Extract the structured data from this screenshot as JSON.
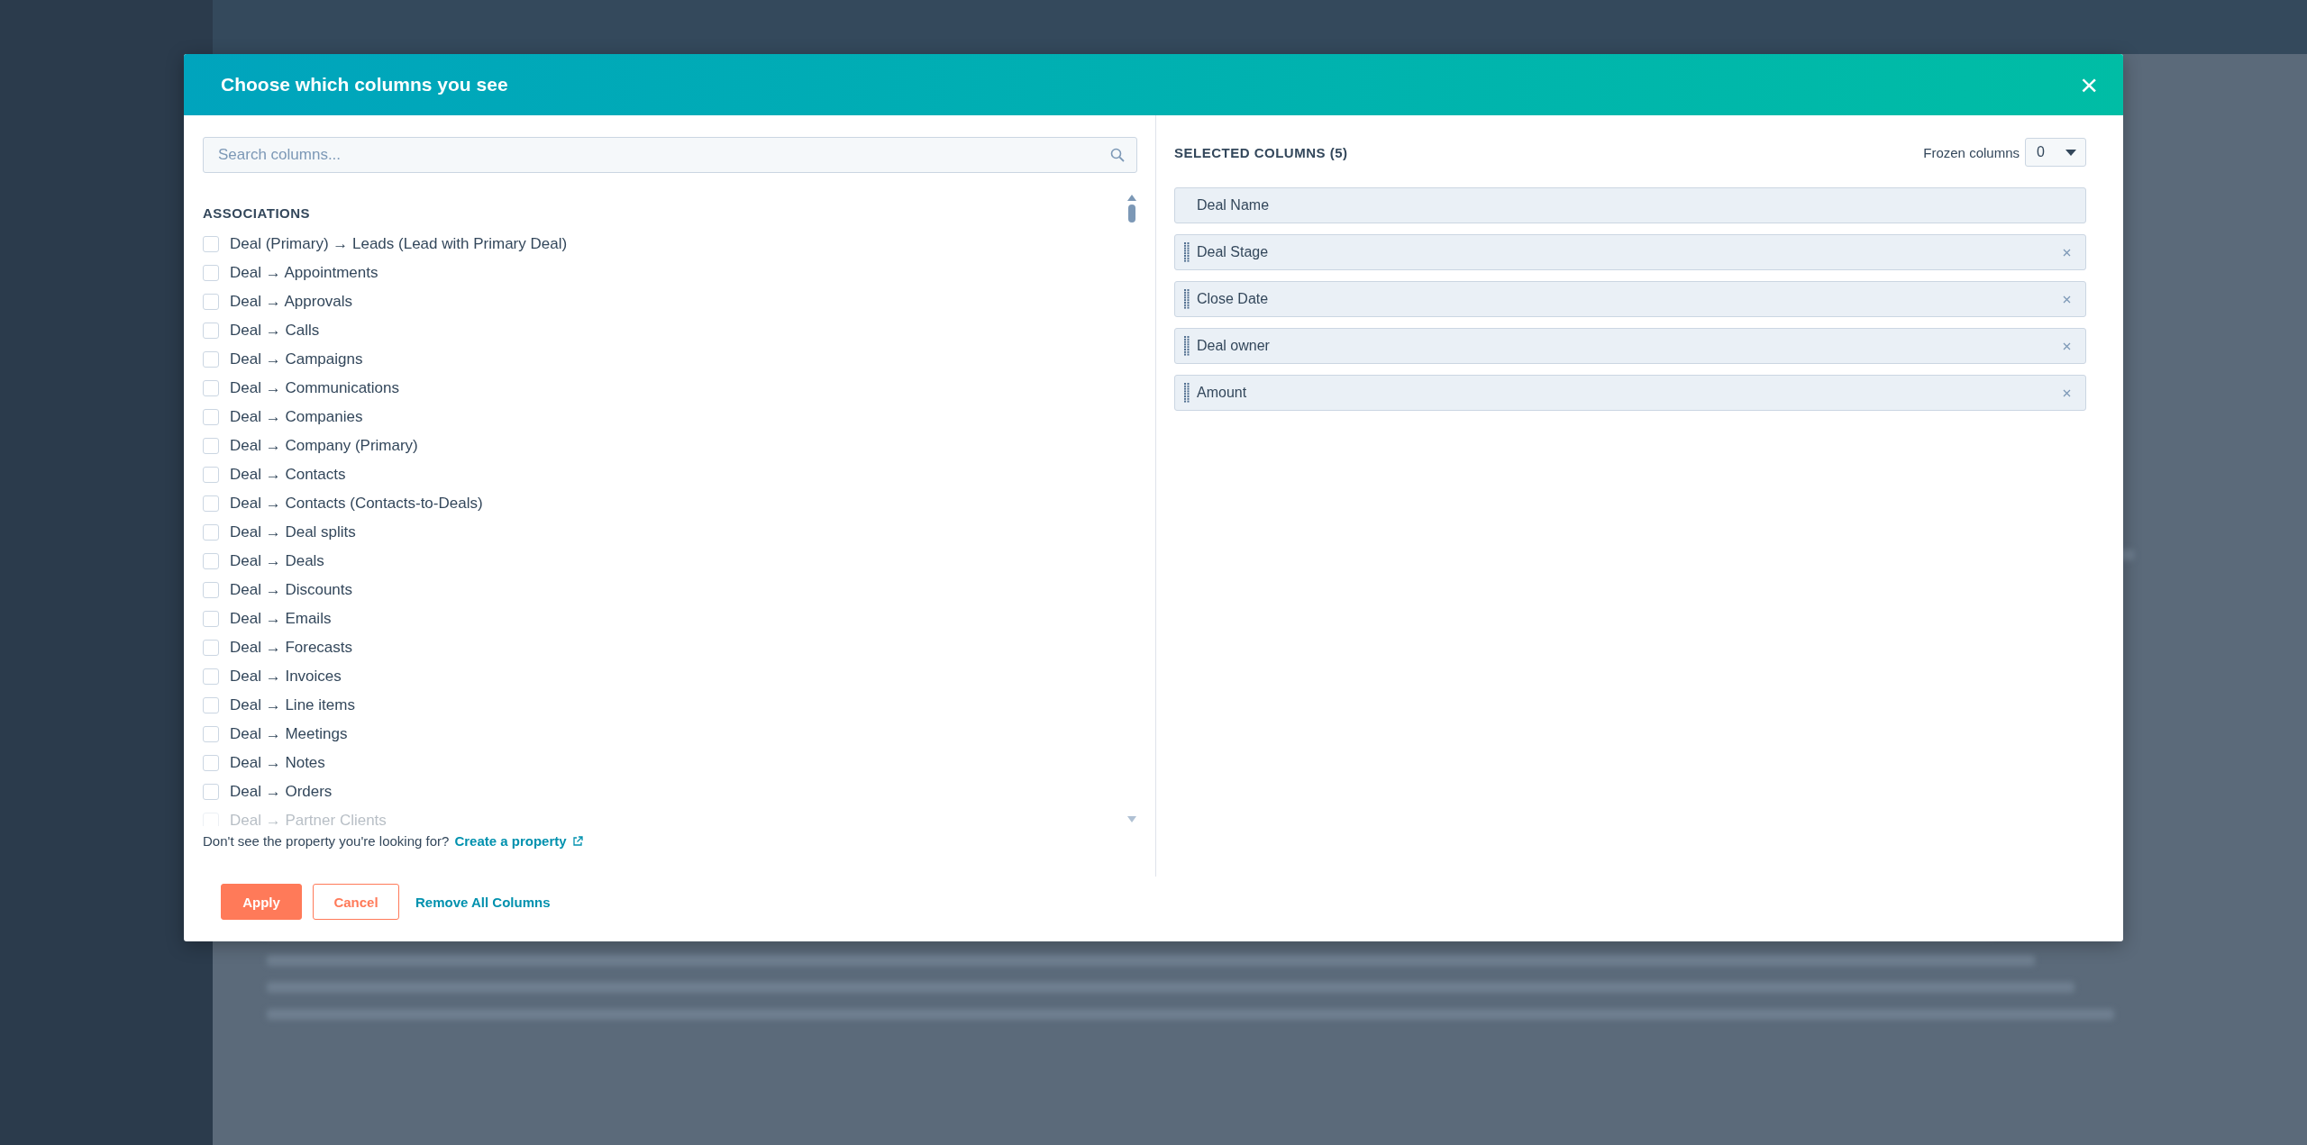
{
  "dialog": {
    "title": "Choose which columns you see",
    "close": "×"
  },
  "search": {
    "placeholder": "Search columns..."
  },
  "section": {
    "title": "ASSOCIATIONS",
    "items": [
      {
        "label": "Deal (Primary) → Leads (Lead with Primary Deal)",
        "checked": false
      },
      {
        "label": "Deal → Appointments",
        "checked": false
      },
      {
        "label": "Deal → Approvals",
        "checked": false
      },
      {
        "label": "Deal → Calls",
        "checked": false
      },
      {
        "label": "Deal → Campaigns",
        "checked": false
      },
      {
        "label": "Deal → Communications",
        "checked": false
      },
      {
        "label": "Deal → Companies",
        "checked": false
      },
      {
        "label": "Deal → Company (Primary)",
        "checked": false
      },
      {
        "label": "Deal → Contacts",
        "checked": false
      },
      {
        "label": "Deal → Contacts (Contacts-to-Deals)",
        "checked": false
      },
      {
        "label": "Deal → Deal splits",
        "checked": false
      },
      {
        "label": "Deal → Deals",
        "checked": false
      },
      {
        "label": "Deal → Discounts",
        "checked": false
      },
      {
        "label": "Deal → Emails",
        "checked": false
      },
      {
        "label": "Deal → Forecasts",
        "checked": false
      },
      {
        "label": "Deal → Invoices",
        "checked": false
      },
      {
        "label": "Deal → Line items",
        "checked": false
      },
      {
        "label": "Deal → Meetings",
        "checked": false
      },
      {
        "label": "Deal → Notes",
        "checked": false
      },
      {
        "label": "Deal → Orders",
        "checked": false
      },
      {
        "label": "Deal → Partner Clients",
        "checked": false
      }
    ]
  },
  "hint": {
    "text": "Don't see the property you're looking for?",
    "link": "Create a property"
  },
  "selected": {
    "title": "SELECTED COLUMNS (5)",
    "frozen_label": "Frozen columns",
    "frozen_value": "0",
    "items": [
      {
        "label": "Deal Name",
        "removable": false
      },
      {
        "label": "Deal Stage",
        "removable": true
      },
      {
        "label": "Close Date",
        "removable": true
      },
      {
        "label": "Deal owner",
        "removable": true
      },
      {
        "label": "Amount",
        "removable": true
      }
    ]
  },
  "buttons": {
    "apply": "Apply",
    "cancel": "Cancel",
    "remove_all": "Remove All Columns"
  }
}
